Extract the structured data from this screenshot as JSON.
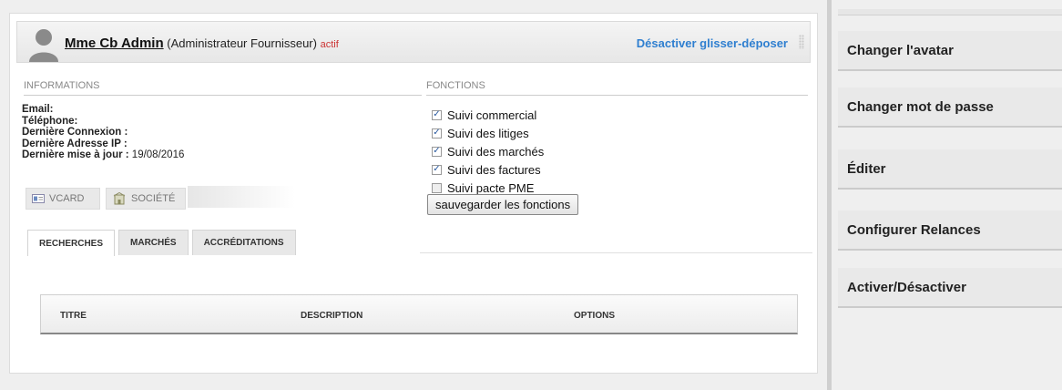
{
  "header": {
    "user_name": "Mme Cb Admin",
    "role": "(Administrateur Fournisseur)",
    "status": "actif",
    "dnd_link": "Désactiver glisser-déposer"
  },
  "informations": {
    "title": "INFORMATIONS",
    "rows": [
      {
        "label": "Email:",
        "value": ""
      },
      {
        "label": "Téléphone:",
        "value": ""
      },
      {
        "label": "Dernière Connexion :",
        "value": ""
      },
      {
        "label": "Dernière Adresse IP :",
        "value": ""
      },
      {
        "label": "Dernière mise à jour :",
        "value": " 19/08/2016"
      }
    ],
    "vcard_label": "VCARD",
    "societe_label": "SOCIÉTÉ"
  },
  "fonctions": {
    "title": "FONCTIONS",
    "items": [
      {
        "label": "Suivi commercial",
        "checked": true
      },
      {
        "label": "Suivi des litiges",
        "checked": true
      },
      {
        "label": "Suivi des marchés",
        "checked": true
      },
      {
        "label": "Suivi des factures",
        "checked": true
      },
      {
        "label": "Suivi pacte PME",
        "checked": false
      }
    ],
    "save_label": "sauvegarder les fonctions"
  },
  "tabs": [
    "RECHERCHES",
    "MARCHÉS",
    "ACCRÉDITATIONS"
  ],
  "table": {
    "columns": [
      "TITRE",
      "DESCRIPTION",
      "OPTIONS"
    ]
  },
  "sidebar": {
    "buttons": [
      "Changer l'avatar",
      "Changer mot de passe",
      "Éditer",
      "Configurer Relances",
      "Activer/Désactiver"
    ]
  },
  "icons": [
    "user-avatar-icon",
    "drag-grip-icon",
    "vcard-icon",
    "building-icon"
  ],
  "colors": {
    "link": "#2f7fd0",
    "status": "#cc3333"
  }
}
